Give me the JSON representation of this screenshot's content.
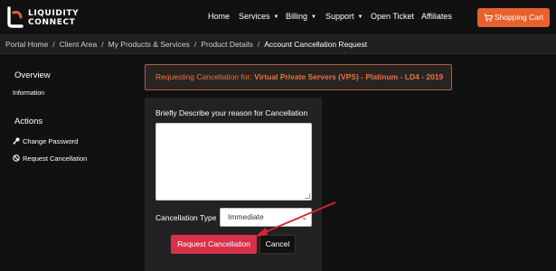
{
  "brand": {
    "line1": "LIQUIDITY",
    "line2": "CONNECT",
    "accent_color": "#e8612c"
  },
  "nav": {
    "items": [
      {
        "label": "Home",
        "dropdown": false
      },
      {
        "label": "Services",
        "dropdown": true
      },
      {
        "label": "Billing",
        "dropdown": true
      },
      {
        "label": "Support",
        "dropdown": true
      },
      {
        "label": "Open Ticket",
        "dropdown": false
      },
      {
        "label": "Affiliates",
        "dropdown": false
      }
    ],
    "cart_label": "Shopping Cart",
    "cart_icon": "shopping-cart-icon"
  },
  "breadcrumb": {
    "items": [
      "Portal Home",
      "Client Area",
      "My Products & Services",
      "Product Details"
    ],
    "current": "Account Cancellation Request",
    "separator": "/"
  },
  "sidebar": {
    "overview_heading": "Overview",
    "overview_item": "Information",
    "actions_heading": "Actions",
    "actions": [
      {
        "label": "Change Password",
        "icon": "key-icon"
      },
      {
        "label": "Request Cancellation",
        "icon": "ban-icon"
      }
    ]
  },
  "alert": {
    "prefix": "Requesting Cancellation for:",
    "product": "Virtual Private Servers (VPS) - Platinum - LD4 - 2019",
    "color": "#e8743f"
  },
  "form": {
    "reason_label": "Briefly Describe your reason for Cancellation",
    "reason_value": "",
    "type_label": "Cancellation Type",
    "type_selected": "Immediate",
    "submit_label": "Request Cancellation",
    "cancel_label": "Cancel",
    "submit_color": "#d9304a"
  },
  "annotation": {
    "arrow_color": "#d9242e"
  }
}
